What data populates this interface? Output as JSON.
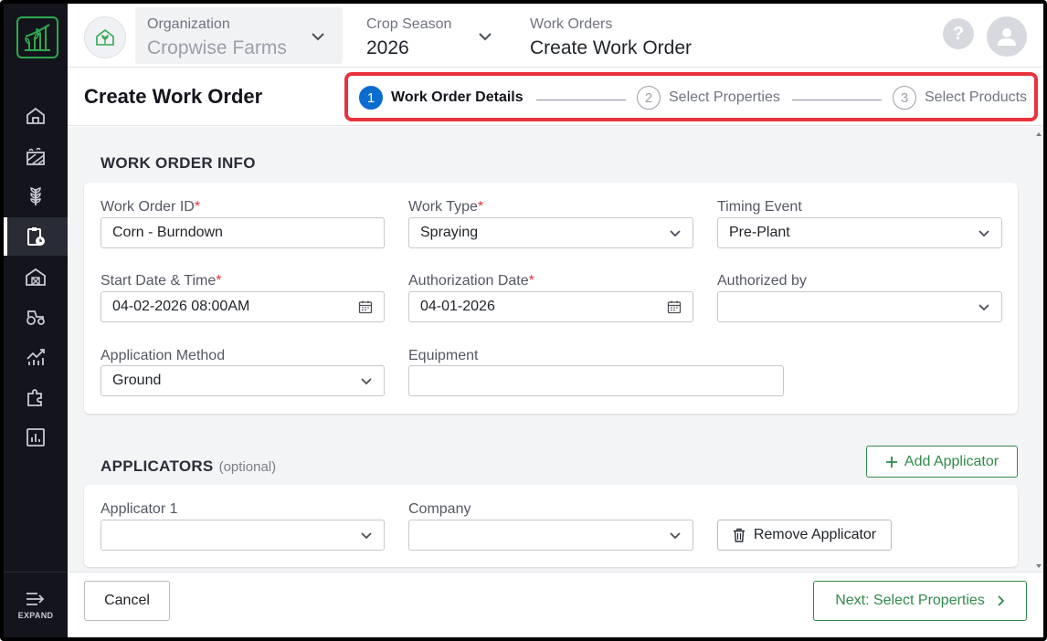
{
  "header": {
    "organization_label": "Organization",
    "organization_value": "Cropwise Farms",
    "crop_season_label": "Crop Season",
    "crop_season_value": "2026",
    "breadcrumb_label": "Work Orders",
    "breadcrumb_value": "Create Work Order",
    "help_symbol": "?"
  },
  "sidebar": {
    "items": [
      {
        "icon": "home-icon"
      },
      {
        "icon": "fields-icon"
      },
      {
        "icon": "crop-icon"
      },
      {
        "icon": "work-order-icon",
        "active": true
      },
      {
        "icon": "barn-icon"
      },
      {
        "icon": "tractor-icon"
      },
      {
        "icon": "yield-icon"
      },
      {
        "icon": "integrations-icon"
      },
      {
        "icon": "reports-icon"
      }
    ],
    "expand_label": "EXPAND"
  },
  "page": {
    "title": "Create Work Order"
  },
  "stepper": {
    "steps": [
      {
        "number": "1",
        "label": "Work Order Details",
        "active": true
      },
      {
        "number": "2",
        "label": "Select Properties",
        "active": false
      },
      {
        "number": "3",
        "label": "Select Products",
        "active": false
      }
    ]
  },
  "work_order_info": {
    "section_title": "WORK ORDER INFO",
    "required_mark": "*",
    "work_order_id": {
      "label": "Work Order ID",
      "value": "Corn - Burndown"
    },
    "work_type": {
      "label": "Work Type",
      "value": "Spraying"
    },
    "timing_event": {
      "label": "Timing Event",
      "value": "Pre-Plant"
    },
    "start_date": {
      "label": "Start Date & Time",
      "value": "04-02-2026 08:00AM"
    },
    "authorization_date": {
      "label": "Authorization Date",
      "value": "04-01-2026"
    },
    "authorized_by": {
      "label": "Authorized by",
      "value": ""
    },
    "application_method": {
      "label": "Application Method",
      "value": "Ground"
    },
    "equipment": {
      "label": "Equipment",
      "value": ""
    }
  },
  "applicators": {
    "section_title": "APPLICATORS",
    "optional_label": "(optional)",
    "add_button": "Add Applicator",
    "applicator_label": "Applicator 1",
    "applicator_value": "",
    "company_label": "Company",
    "company_value": "",
    "remove_button": "Remove Applicator"
  },
  "footer": {
    "cancel_label": "Cancel",
    "next_label": "Next: Select Properties"
  },
  "colors": {
    "sidebar_bg": "#14151c",
    "brand_green": "#2fa84f",
    "accent_blue": "#0a6ccf",
    "highlight_red": "#e8323c",
    "button_green": "#2e8b4a"
  }
}
